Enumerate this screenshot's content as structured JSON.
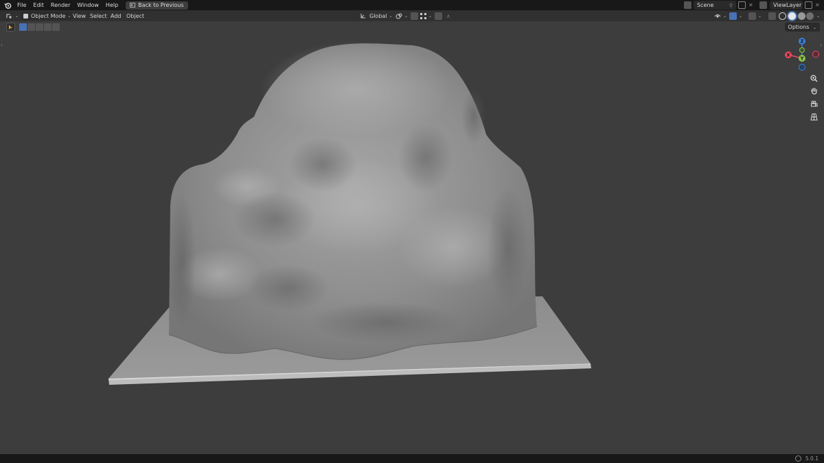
{
  "topbar": {
    "menus": [
      "File",
      "Edit",
      "Render",
      "Window",
      "Help"
    ],
    "back_button": "Back to Previous",
    "scene": "Scene",
    "view_layer": "ViewLayer"
  },
  "header": {
    "mode": "Object Mode",
    "menus": [
      "View",
      "Select",
      "Add",
      "Object"
    ],
    "transform_orientation": "Global"
  },
  "toolbar": {
    "options_label": "Options"
  },
  "gizmo": {
    "z": "Z",
    "y": "Y",
    "x": "X"
  },
  "status": {
    "version": "5.0.1"
  },
  "colors": {
    "x_axis": "#e84a5f",
    "y_axis": "#8bc34a",
    "z_axis": "#3f7fd9",
    "viewport_bg": "#3d3d3d"
  }
}
